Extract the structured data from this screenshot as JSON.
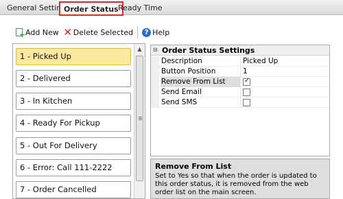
{
  "tabs": [
    {
      "label": "General Settings"
    },
    {
      "label": "Order Status"
    },
    {
      "label": "Ready Time"
    }
  ],
  "toolbar": {
    "add_label": "Add New",
    "delete_label": "Delete Selected",
    "help_label": "Help"
  },
  "statuses": [
    {
      "label": "1 - Picked Up",
      "selected": true
    },
    {
      "label": "2 - Delivered"
    },
    {
      "label": "3 - In Kitchen"
    },
    {
      "label": "4 - Ready For Pickup"
    },
    {
      "label": "5 - Out For Delivery"
    },
    {
      "label": "6 - Error: Call 111-2222"
    },
    {
      "label": "7 - Order Cancelled"
    }
  ],
  "property_grid": {
    "category": "Order Status Settings",
    "rows": [
      {
        "name": "Description",
        "value": "Picked Up"
      },
      {
        "name": "Button Position",
        "value": "1"
      },
      {
        "name": "Remove From List",
        "checked": true
      },
      {
        "name": "Send Email",
        "checked": false
      },
      {
        "name": "Send SMS",
        "checked": false
      }
    ]
  },
  "description": {
    "title": "Remove From List",
    "text": "Set to Yes so that when the order is updated to this order status, it is removed from the web order list on the main screen."
  }
}
